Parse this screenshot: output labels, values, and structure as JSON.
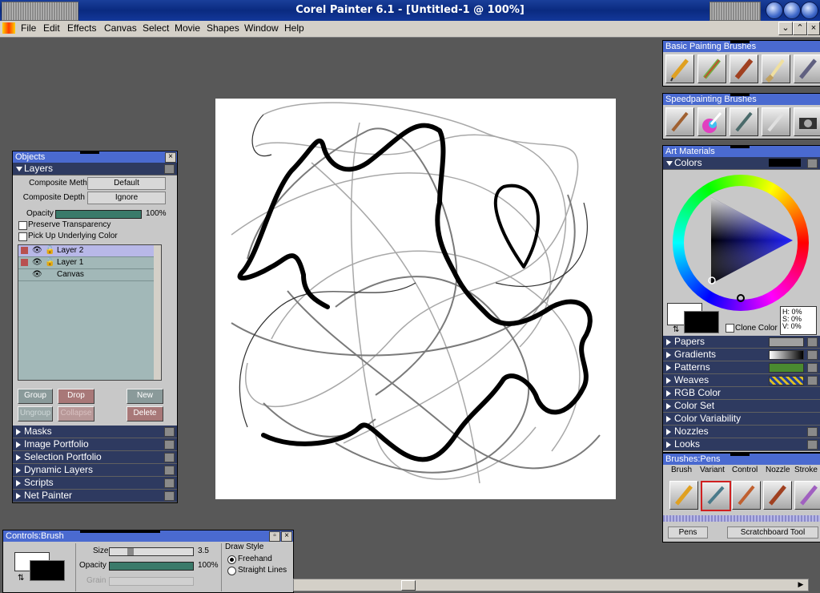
{
  "window": {
    "title": "Corel Painter 6.1 - [Untitled-1 @ 100%]"
  },
  "menu": [
    "File",
    "Edit",
    "Effects",
    "Canvas",
    "Select",
    "Movie",
    "Shapes",
    "Window",
    "Help"
  ],
  "objects": {
    "title": "Objects",
    "layers_label": "Layers",
    "composite_method_label": "Composite Method",
    "composite_method_value": "Default",
    "composite_depth_label": "Composite Depth",
    "composite_depth_value": "Ignore",
    "opacity_label": "Opacity",
    "opacity_value": "100%",
    "opacity_fraction": 1.0,
    "preserve_label": "Preserve Transparency",
    "pickup_label": "Pick Up Underlying Color",
    "layers": [
      "Layer 2",
      "Layer 1",
      "Canvas"
    ],
    "buttons": {
      "group": "Group",
      "drop": "Drop",
      "new": "New",
      "ungroup": "Ungroup",
      "collapse": "Collapse",
      "delete": "Delete"
    },
    "sections": [
      "Masks",
      "Image Portfolio",
      "Selection Portfolio",
      "Dynamic Layers",
      "Scripts",
      "Net Painter"
    ]
  },
  "basic_brushes": {
    "title": "Basic Painting Brushes"
  },
  "speed_brushes": {
    "title": "Speedpainting Brushes"
  },
  "art_materials": {
    "title": "Art Materials",
    "colors_label": "Colors",
    "hsv": {
      "h": "H:  0%",
      "s": "S:  0%",
      "v": "V:  0%"
    },
    "clone_label": "Clone Color",
    "sections": [
      "Papers",
      "Gradients",
      "Patterns",
      "Weaves",
      "RGB Color",
      "Color Set",
      "Color Variability",
      "Nozzles",
      "Looks"
    ]
  },
  "brushes_pens": {
    "title": "Brushes:Pens",
    "tabs": [
      "Brush",
      "Variant",
      "Control",
      "Nozzle",
      "Stroke"
    ],
    "brush_label": "Pens",
    "variant_label": "Scratchboard Tool"
  },
  "controls": {
    "title": "Controls:Brush",
    "size_label": "Size",
    "size_value": "3.5",
    "opacity_label": "Opacity",
    "opacity_value": "100%",
    "grain_label": "Grain",
    "draw_style_label": "Draw Style",
    "freehand_label": "Freehand",
    "straight_label": "Straight Lines"
  },
  "colors": {
    "accent": "#4a6ad0",
    "title_bar": "#0a2a80",
    "section_bg": "#2e3a60"
  }
}
